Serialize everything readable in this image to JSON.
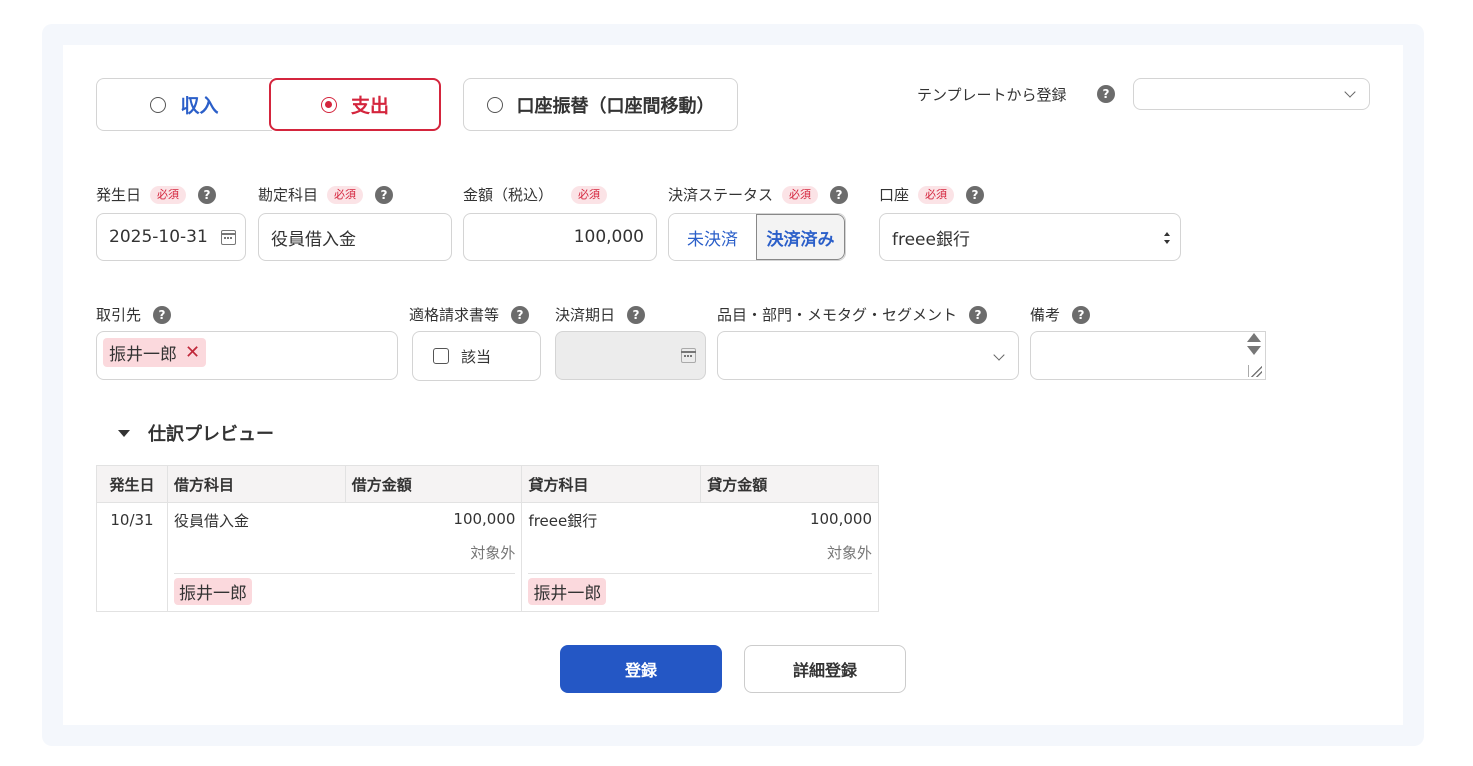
{
  "type_selector": {
    "income": "収入",
    "expense": "支出",
    "transfer": "口座振替（口座間移動）",
    "selected": "expense"
  },
  "template": {
    "label": "テンプレートから登録",
    "value": ""
  },
  "required_badge": "必須",
  "help_glyph": "?",
  "fields": {
    "date": {
      "label": "発生日",
      "value": "2025-10-31"
    },
    "account_item": {
      "label": "勘定科目",
      "value": "役員借入金"
    },
    "amount": {
      "label": "金額（税込）",
      "value": "100,000"
    },
    "settlement_status": {
      "label": "決済ステータス",
      "options": [
        "未決済",
        "決済済み"
      ],
      "selected": "決済済み"
    },
    "wallet": {
      "label": "口座",
      "value": "freee銀行"
    },
    "partner": {
      "label": "取引先",
      "tag": "振井一郎",
      "remove_glyph": "✕"
    },
    "invoice": {
      "label": "適格請求書等",
      "checkbox_label": "該当",
      "checked": false
    },
    "due_date": {
      "label": "決済期日",
      "value": ""
    },
    "tags": {
      "label": "品目・部門・メモタグ・セグメント",
      "value": ""
    },
    "memo": {
      "label": "備考",
      "value": ""
    }
  },
  "preview": {
    "title": "仕訳プレビュー",
    "headers": [
      "発生日",
      "借方科目",
      "借方金額",
      "貸方科目",
      "貸方金額"
    ],
    "row": {
      "date": "10/31",
      "debit_item": "役員借入金",
      "debit_amount": "100,000",
      "debit_tax": "対象外",
      "debit_partner": "振井一郎",
      "credit_item": "freee銀行",
      "credit_amount": "100,000",
      "credit_tax": "対象外",
      "credit_partner": "振井一郎"
    }
  },
  "actions": {
    "register": "登録",
    "detail_register": "詳細登録"
  },
  "colors": {
    "accent_blue": "#2457c5",
    "expense_red": "#d4253d",
    "tag_pink": "#fbd9dd"
  }
}
